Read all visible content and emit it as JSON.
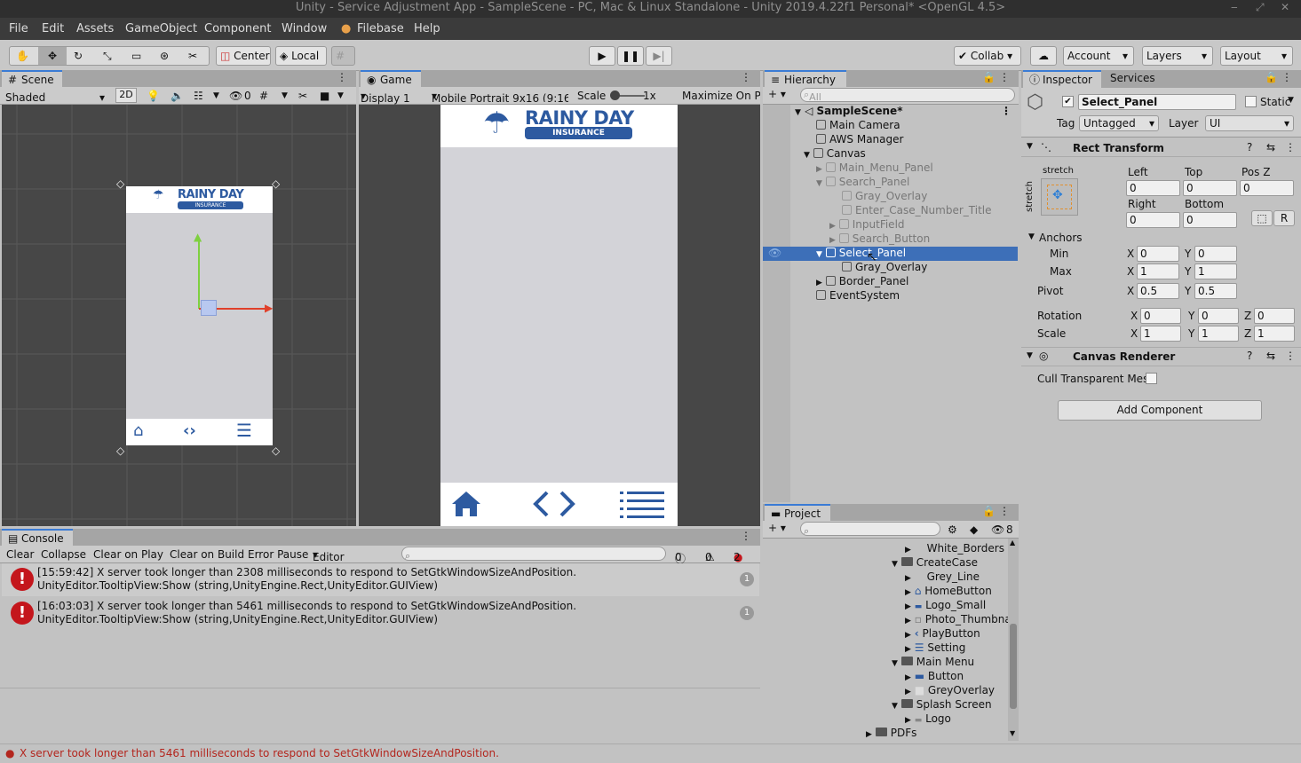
{
  "window": {
    "title": "Unity - Service Adjustment App - SampleScene - PC, Mac & Linux Standalone - Unity 2019.4.22f1 Personal* <OpenGL 4.5>"
  },
  "menu": [
    "File",
    "Edit",
    "Assets",
    "GameObject",
    "Component",
    "Window",
    "Filebase",
    "Help"
  ],
  "toolbar": {
    "center": "Center",
    "local": "Local",
    "collab": "Collab",
    "account": "Account",
    "layers": "Layers",
    "layout": "Layout"
  },
  "scene": {
    "tab": "Scene",
    "shading": "Shaded",
    "mode2d": "2D",
    "hidden_count": "0"
  },
  "game": {
    "tab": "Game",
    "display": "Display 1",
    "resolution": "Mobile Portrait 9x16 (9:16",
    "scale_label": "Scale",
    "scale_value": "1x",
    "maximize": "Maximize On Pl",
    "logo_title": "RAINY DAY",
    "logo_sub": "INSURANCE"
  },
  "hierarchy": {
    "tab": "Hierarchy",
    "search_placeholder": "All",
    "items": [
      {
        "label": "SampleScene*"
      },
      {
        "label": "Main Camera"
      },
      {
        "label": "AWS Manager"
      },
      {
        "label": "Canvas"
      },
      {
        "label": "Main_Menu_Panel"
      },
      {
        "label": "Search_Panel"
      },
      {
        "label": "Gray_Overlay"
      },
      {
        "label": "Enter_Case_Number_Title"
      },
      {
        "label": "InputField"
      },
      {
        "label": "Search_Button"
      },
      {
        "label": "Select_Panel"
      },
      {
        "label": "Gray_Overlay"
      },
      {
        "label": "Border_Panel"
      },
      {
        "label": "EventSystem"
      }
    ]
  },
  "project": {
    "tab": "Project",
    "hidden_count": "8",
    "items": [
      {
        "label": "White_Borders"
      },
      {
        "label": "CreateCase"
      },
      {
        "label": "Grey_Line"
      },
      {
        "label": "HomeButton"
      },
      {
        "label": "Logo_Small"
      },
      {
        "label": "Photo_Thumbna"
      },
      {
        "label": "PlayButton"
      },
      {
        "label": "Setting"
      },
      {
        "label": "Main Menu"
      },
      {
        "label": "Button"
      },
      {
        "label": "GreyOverlay"
      },
      {
        "label": "Splash Screen"
      },
      {
        "label": "Logo"
      },
      {
        "label": "PDFs"
      }
    ]
  },
  "inspector": {
    "tab": "Inspector",
    "tab2": "Services",
    "object_name": "Select_Panel",
    "static_label": "Static",
    "tag_label": "Tag",
    "tag_value": "Untagged",
    "layer_label": "Layer",
    "layer_value": "UI",
    "rect_title": "Rect Transform",
    "stretch_top": "stretch",
    "stretch_side": "stretch",
    "left_label": "Left",
    "top_label": "Top",
    "posz_label": "Pos Z",
    "left": "0",
    "top": "0",
    "posz": "0",
    "right_label": "Right",
    "bottom_label": "Bottom",
    "right": "0",
    "bottom": "0",
    "r_btn": "R",
    "anchors": "Anchors",
    "min": "Min",
    "max": "Max",
    "pivot": "Pivot",
    "x": "X",
    "y": "Y",
    "z": "Z",
    "min_x": "0",
    "min_y": "0",
    "max_x": "1",
    "max_y": "1",
    "pivot_x": "0.5",
    "pivot_y": "0.5",
    "rotation": "Rotation",
    "rot_x": "0",
    "rot_y": "0",
    "rot_z": "0",
    "scale": "Scale",
    "scale_x": "1",
    "scale_y": "1",
    "scale_z": "1",
    "canvas_renderer": "Canvas Renderer",
    "cull": "Cull Transparent Mes",
    "add_component": "Add Component"
  },
  "console": {
    "tab": "Console",
    "buttons": [
      "Clear",
      "Collapse",
      "Clear on Play",
      "Clear on Build",
      "Error Pause",
      "Editor"
    ],
    "info_count": "0",
    "warn_count": "0",
    "error_count": "2",
    "messages": [
      {
        "line1": "[15:59:42] X server took longer than 2308 milliseconds to respond to SetGtkWindowSizeAndPosition.",
        "line2": "UnityEditor.TooltipView:Show (string,UnityEngine.Rect,UnityEditor.GUIView)",
        "count": "1"
      },
      {
        "line1": "[16:03:03] X server took longer than 5461 milliseconds to respond to SetGtkWindowSizeAndPosition.",
        "line2": "UnityEditor.TooltipView:Show (string,UnityEngine.Rect,UnityEditor.GUIView)",
        "count": "1"
      }
    ]
  },
  "status": "X server took longer than 5461 milliseconds to respond to SetGtkWindowSizeAndPosition."
}
